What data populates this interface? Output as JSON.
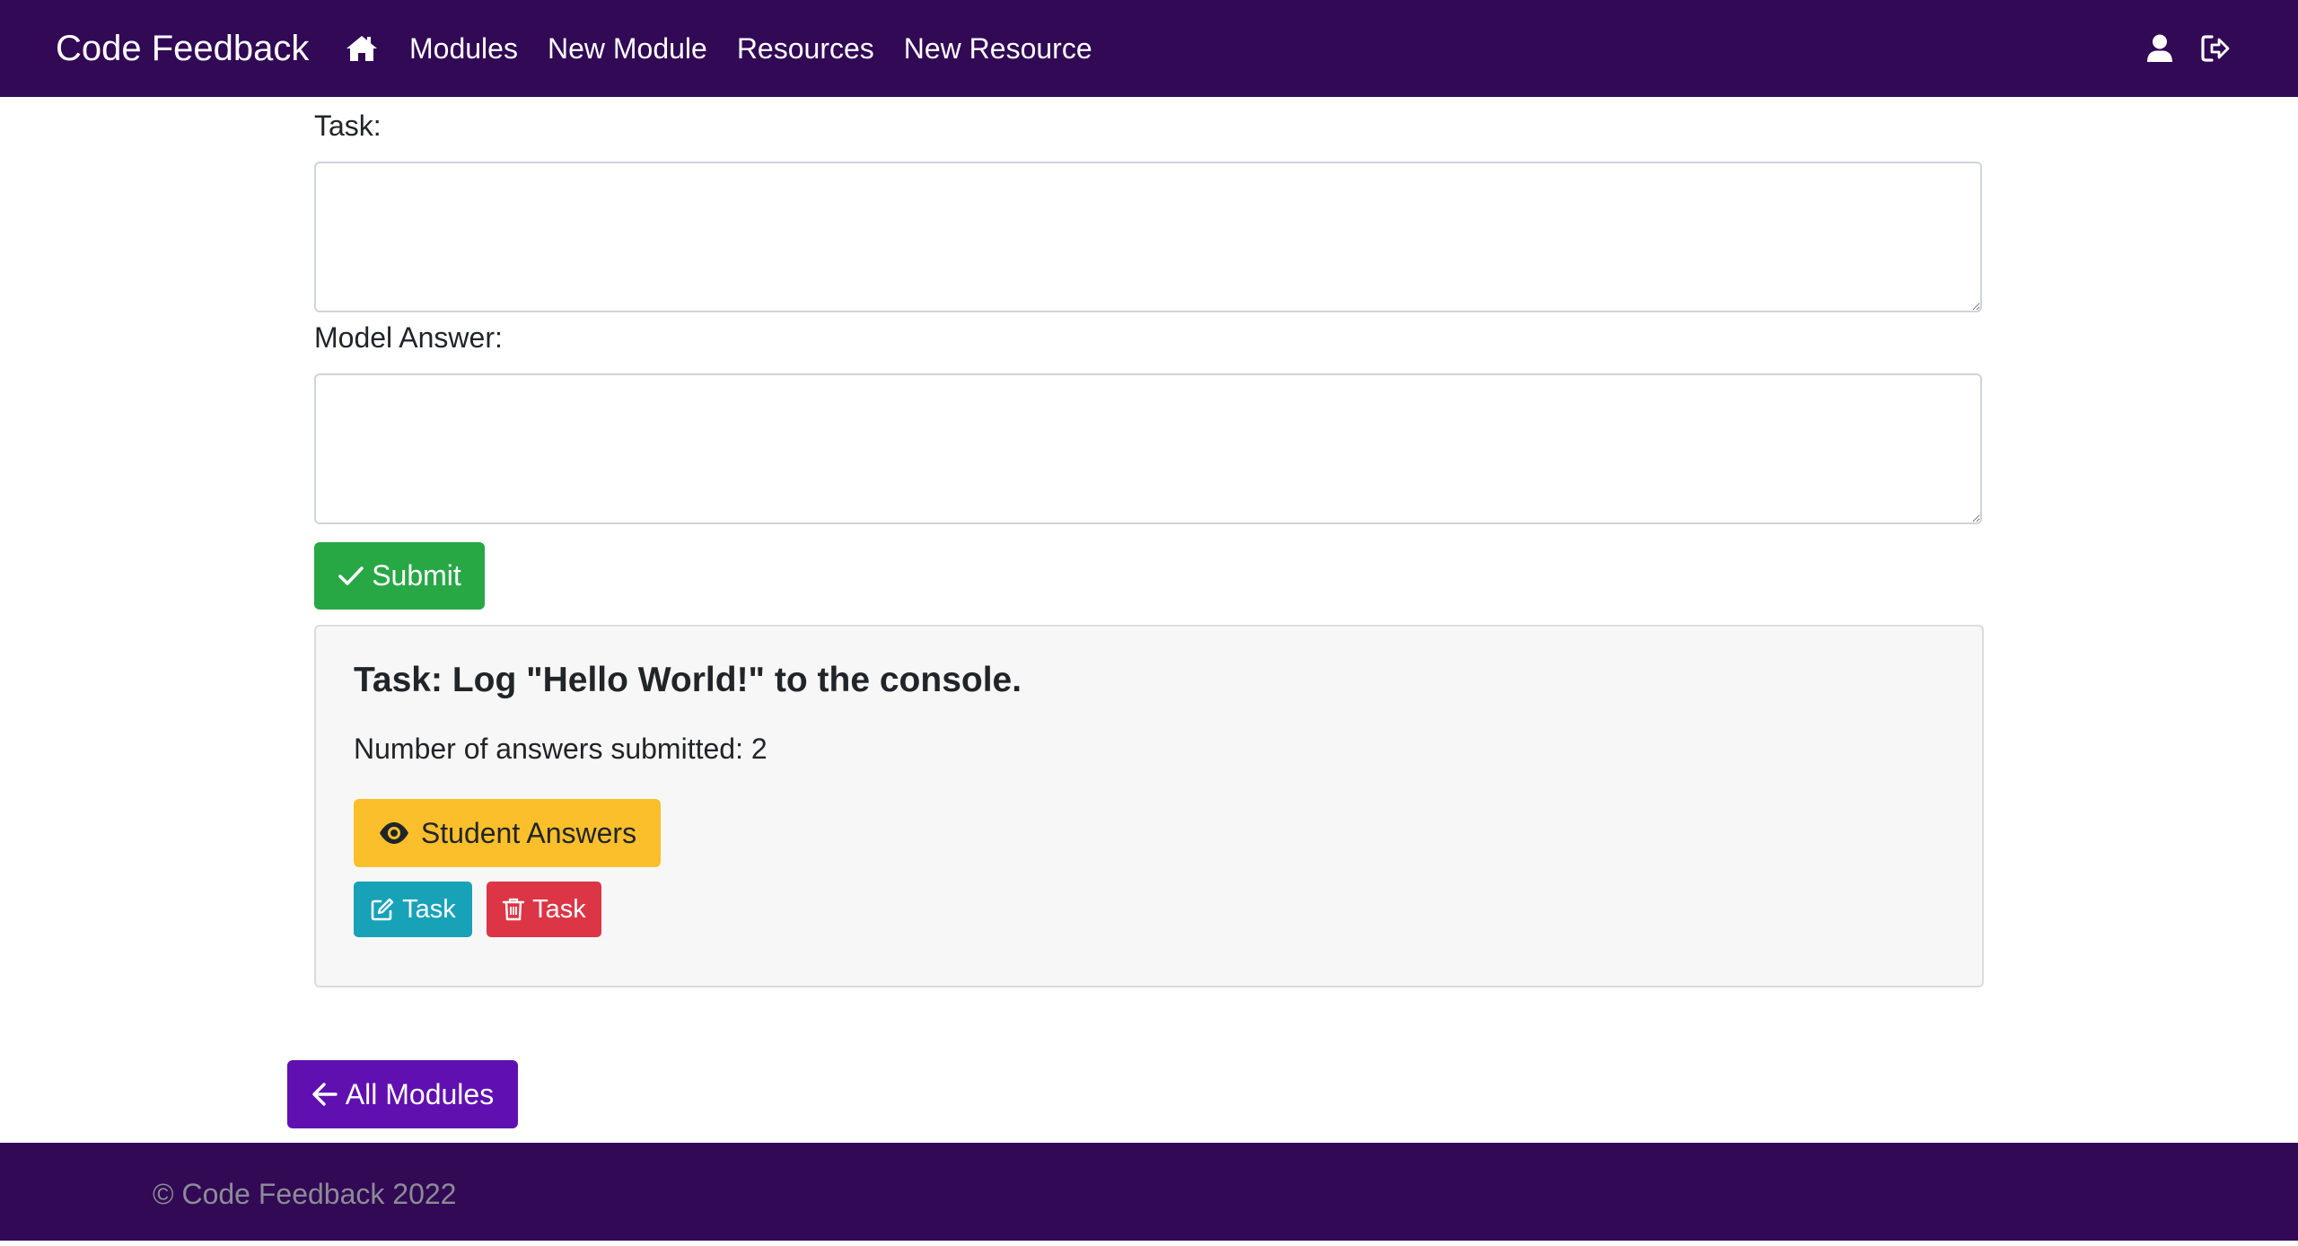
{
  "navbar": {
    "brand": "Code Feedback",
    "links": [
      "Modules",
      "New Module",
      "Resources",
      "New Resource"
    ],
    "icons": {
      "home": "home-icon",
      "profile": "user-icon",
      "logout": "sign-out-icon"
    },
    "background": "#310955"
  },
  "form": {
    "task_label": "Task:",
    "task_value": "",
    "model_answer_label": "Model Answer:",
    "model_answer_value": "",
    "submit_label": "Submit"
  },
  "task_card": {
    "title": "Task: Log \"Hello World!\" to the console.",
    "answers_count_text": "Number of answers submitted: 2",
    "student_answers_label": "Student Answers",
    "edit_label": "Task",
    "delete_label": "Task"
  },
  "back_button_label": "All Modules",
  "footer": {
    "copyright": "© Code Feedback 2022"
  },
  "colors": {
    "navbar": "#310955",
    "submit": "#28a745",
    "student_answers": "#fbbf2c",
    "edit": "#17a2b8",
    "delete": "#dc3545",
    "back": "#6010b1"
  }
}
